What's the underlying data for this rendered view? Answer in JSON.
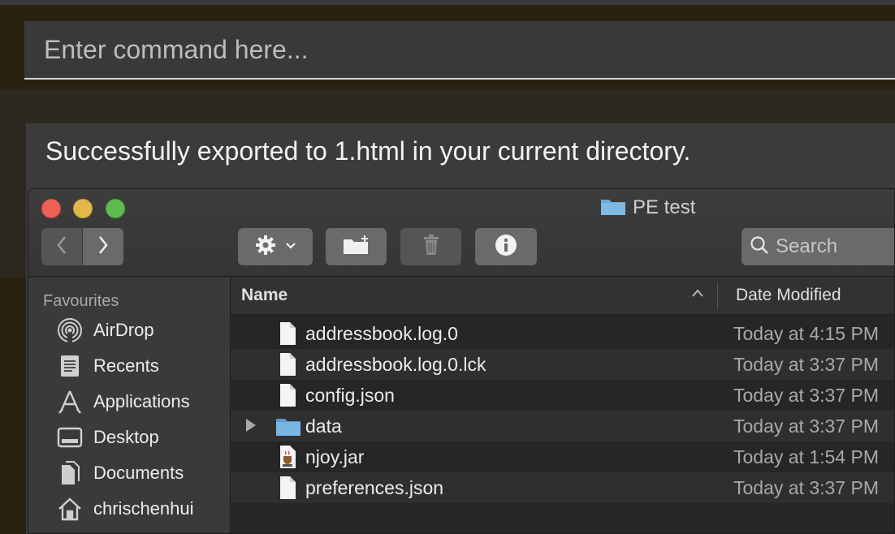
{
  "command": {
    "placeholder": "Enter command here..."
  },
  "result": {
    "message": "Successfully exported to 1.html in your current directory."
  },
  "finder": {
    "title": "PE test",
    "toolbar": {
      "search_placeholder": "Search"
    },
    "sidebar": {
      "heading": "Favourites",
      "items": [
        {
          "label": "AirDrop",
          "icon": "airdrop-icon"
        },
        {
          "label": "Recents",
          "icon": "recents-icon"
        },
        {
          "label": "Applications",
          "icon": "applications-icon"
        },
        {
          "label": "Desktop",
          "icon": "desktop-icon"
        },
        {
          "label": "Documents",
          "icon": "documents-icon"
        },
        {
          "label": "chrischenhui",
          "icon": "home-icon"
        }
      ]
    },
    "columns": {
      "name": "Name",
      "date": "Date Modified"
    },
    "files": [
      {
        "name": "addressbook.log.0",
        "date": "Today at 4:15 PM",
        "kind": "file"
      },
      {
        "name": "addressbook.log.0.lck",
        "date": "Today at 3:37 PM",
        "kind": "file"
      },
      {
        "name": "config.json",
        "date": "Today at 3:37 PM",
        "kind": "file"
      },
      {
        "name": "data",
        "date": "Today at 3:37 PM",
        "kind": "folder"
      },
      {
        "name": "njoy.jar",
        "date": "Today at 1:54 PM",
        "kind": "jar"
      },
      {
        "name": "preferences.json",
        "date": "Today at 3:37 PM",
        "kind": "file"
      }
    ]
  },
  "colors": {
    "background": "#2a2110",
    "panel": "#3b3b3b",
    "close": "#ed5f57",
    "minimize": "#e0b94a",
    "zoom": "#5ebd4e",
    "folder": "#6aa9d8"
  }
}
